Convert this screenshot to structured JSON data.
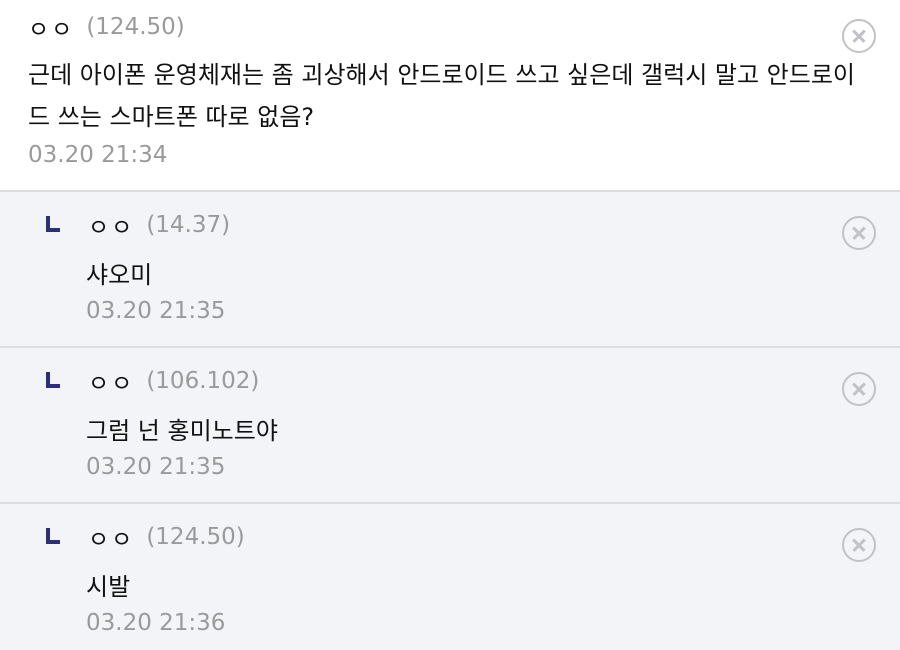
{
  "comments": [
    {
      "nickname": "ㅇㅇ",
      "ip": "(124.50)",
      "text": "근데 아이폰 운영체재는 좀 괴상해서 안드로이드 쓰고 싶은데 갤럭시 말고 안드로이드 쓰는 스마트폰 따로 없음?",
      "time": "03.20 21:34"
    }
  ],
  "replies": [
    {
      "nickname": "ㅇㅇ",
      "ip": "(14.37)",
      "text": "샤오미",
      "time": "03.20 21:35"
    },
    {
      "nickname": "ㅇㅇ",
      "ip": "(106.102)",
      "text": "그럼 넌 홍미노트야",
      "time": "03.20 21:35"
    },
    {
      "nickname": "ㅇㅇ",
      "ip": "(124.50)",
      "text": "시발",
      "time": "03.20 21:36"
    }
  ],
  "icons": {
    "delete": "close-circle-icon",
    "reply": "reply-arrow-icon"
  },
  "colors": {
    "reply_bg": "#f3f4f8",
    "reply_mark": "#2d2f7a",
    "meta_text": "#9a9a9a"
  }
}
